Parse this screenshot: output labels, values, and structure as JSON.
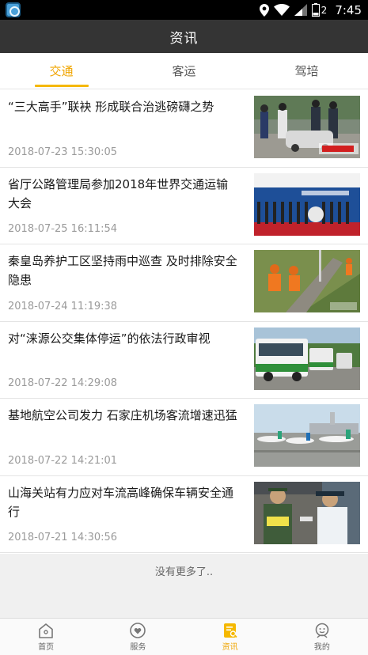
{
  "status_bar": {
    "time": "7:45",
    "battery": "2"
  },
  "header": {
    "title": "资讯"
  },
  "tabs": [
    {
      "label": "交通",
      "active": true
    },
    {
      "label": "客运",
      "active": false
    },
    {
      "label": "驾培",
      "active": false
    }
  ],
  "news": [
    {
      "title": "“三大高手”联袂 形成联合治逃磅礴之势",
      "date": "2018-07-23 15:30:05",
      "thumb": "traffic-police-photo"
    },
    {
      "title": "省厅公路管理局参加2018年世界交通运输大会",
      "date": "2018-07-25 16:11:54",
      "thumb": "conference-stage-photo"
    },
    {
      "title": "秦皇岛养护工区坚持雨中巡查 及时排除安全隐患",
      "date": "2018-07-24 11:19:38",
      "thumb": "road-maintenance-photo"
    },
    {
      "title": "对“涞源公交集体停运”的依法行政审视",
      "date": "2018-07-22 14:29:08",
      "thumb": "bus-photo"
    },
    {
      "title": "基地航空公司发力 石家庄机场客流增速迅猛",
      "date": "2018-07-22 14:21:01",
      "thumb": "airport-photo"
    },
    {
      "title": "山海关站有力应对车流高峰确保车辆安全通行",
      "date": "2018-07-21 14:30:56",
      "thumb": "toll-station-photo"
    }
  ],
  "list_footer": "没有更多了..",
  "bottom_nav": [
    {
      "label": "首页",
      "icon": "home-icon",
      "active": false
    },
    {
      "label": "服务",
      "icon": "service-icon",
      "active": false
    },
    {
      "label": "资讯",
      "icon": "news-icon",
      "active": true
    },
    {
      "label": "我的",
      "icon": "profile-icon",
      "active": false
    }
  ],
  "colors": {
    "accent": "#f5b800",
    "title_bar": "#343434",
    "status_bar": "#000000"
  }
}
